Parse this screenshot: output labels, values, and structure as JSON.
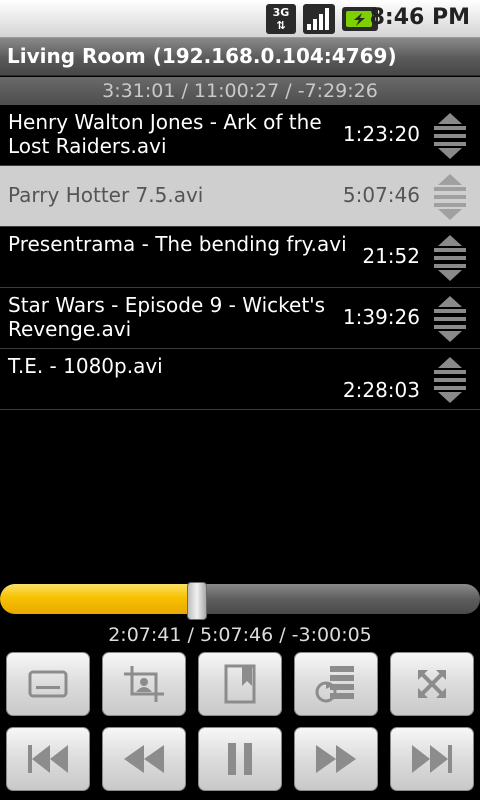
{
  "status_bar": {
    "network": "3G",
    "time": "8:46 PM",
    "icons": [
      "3g-data-icon",
      "signal-strength-icon",
      "battery-charging-icon"
    ]
  },
  "header": {
    "title": "Living Room (192.168.0.104:4769)"
  },
  "playlist": {
    "total_time": "3:31:01 / 11:00:27 / -7:29:26",
    "items": [
      {
        "name": "Henry Walton Jones - Ark of the Lost Raiders.avi",
        "duration": "1:23:20",
        "selected": false
      },
      {
        "name": "Parry Hotter 7.5.avi",
        "duration": "5:07:46",
        "selected": true
      },
      {
        "name": "Presentrama - The bending fry.avi",
        "duration": "21:52",
        "selected": false
      },
      {
        "name": "Star Wars - Episode 9 - Wicket's Revenge.avi",
        "duration": "1:39:26",
        "selected": false
      },
      {
        "name": "T.E. - 1080p.avi",
        "duration": "2:28:03",
        "selected": false
      }
    ]
  },
  "player": {
    "progress_fraction": 0.41,
    "current_time": "2:07:41 / 5:07:46 / -3:00:05"
  },
  "controls": {
    "row1": [
      "subtitles-icon",
      "crop-icon",
      "bookmark-icon",
      "audio-track-icon",
      "fullscreen-icon"
    ],
    "row2": [
      "skip-previous-icon",
      "rewind-icon",
      "pause-icon",
      "fast-forward-icon",
      "skip-next-icon"
    ]
  },
  "colors": {
    "accent": "#f7c200",
    "selected_row": "#cfcfcf"
  }
}
